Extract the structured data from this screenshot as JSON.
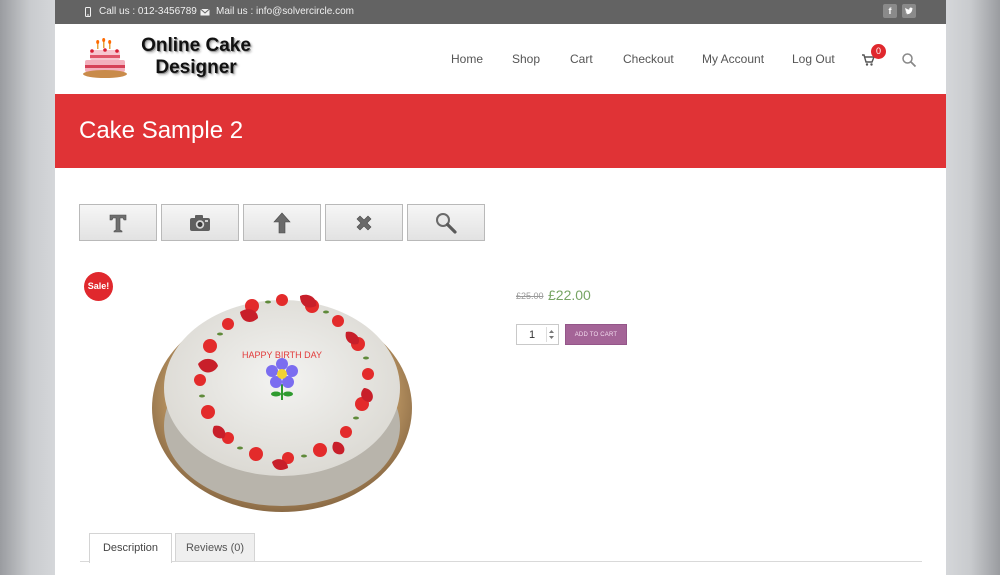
{
  "topbar": {
    "phone": "Call us : 012-3456789",
    "email": "Mail us : info@solvercircle.com",
    "social": [
      "facebook-icon",
      "twitter-icon"
    ]
  },
  "logo": {
    "line1": "Online Cake",
    "line2": "Designer"
  },
  "nav": {
    "items": [
      "Home",
      "Shop",
      "Cart",
      "Checkout",
      "My Account",
      "Log Out"
    ],
    "cart_count": "0"
  },
  "banner": {
    "title": "Cake Sample 2"
  },
  "toolbar": {
    "tools": [
      "text-tool-icon",
      "camera-tool-icon",
      "move-up-tool-icon",
      "delete-tool-icon",
      "zoom-tool-icon"
    ]
  },
  "product": {
    "sale_badge": "Sale!",
    "cake_text": "HAPPY BIRTH DAY",
    "old_price": "£25.00",
    "new_price": "£22.00",
    "quantity": "1",
    "add_to_cart": "ADD TO CART"
  },
  "tabs": [
    "Description",
    "Reviews (0)"
  ],
  "colors": {
    "banner": "#e03336",
    "topbar": "#636363",
    "price": "#77a464",
    "add_to_cart": "#a46497",
    "badge": "#e0282d"
  }
}
